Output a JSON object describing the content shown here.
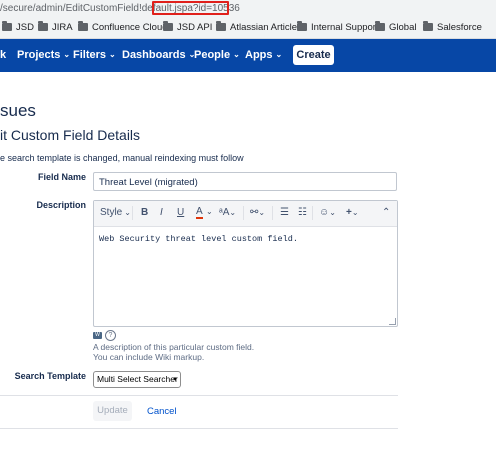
{
  "browser": {
    "url_prefix": "/secure/admin/EditCustomField!default.",
    "url_highlight": "jspa?id=10536",
    "bookmarks": [
      "JSD",
      "JIRA",
      "Confluence Cloud",
      "JSD API",
      "Atlassian Articles",
      "Internal Support",
      "Global",
      "Salesforce"
    ]
  },
  "nav": {
    "partial_item": "k",
    "items": [
      "Projects",
      "Filters",
      "Dashboards",
      "People",
      "Apps"
    ],
    "create_label": "Create"
  },
  "page": {
    "section_title": "sues",
    "form_title": "it Custom Field Details",
    "note": "e search template is changed, manual reindexing must follow"
  },
  "form": {
    "field_name_label": "Field Name",
    "field_name_value": "Threat Level (migrated)",
    "description_label": "Description",
    "description_value": "Web Security threat level custom field.",
    "help_line1": "A description of this particular custom field.",
    "help_line2": "You can include Wiki markup.",
    "search_template_label": "Search Template",
    "search_template_value": "Multi Select Searcher",
    "update_label": "Update",
    "cancel_label": "Cancel"
  },
  "toolbar": {
    "style_label": "Style",
    "bold": "B",
    "italic": "I",
    "underline": "U",
    "text_color": "A",
    "more_text": "ᵃA",
    "link": "⚯",
    "bullet_list": "☰",
    "number_list": "☷",
    "emoji": "☺",
    "insert": "+",
    "collapse": "⌃"
  },
  "colors": {
    "nav_bg": "#0747a6",
    "url_highlight_border": "#e0201b",
    "link": "#0052cc"
  }
}
